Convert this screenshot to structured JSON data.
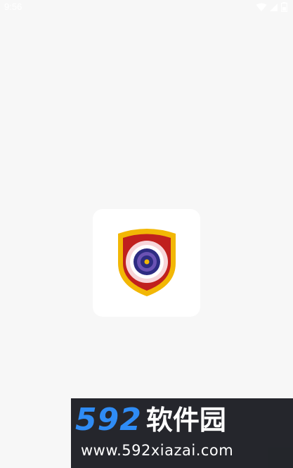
{
  "status_bar": {
    "time": "9:56",
    "icons": [
      "wifi-icon",
      "signal-icon",
      "battery-icon"
    ]
  },
  "splash": {
    "logo": "shield-target-logo",
    "colors": {
      "shield_outer": "#f2b705",
      "shield_inner": "#c0201e",
      "ring_light": "#f7d6da",
      "ring_dark": "#2d2c82",
      "center": "#f2b705"
    }
  },
  "watermark": {
    "brand_number": "592",
    "brand_text": "软件园",
    "url": "www.592xiazai.com",
    "colors": {
      "number": "#2f8cf5",
      "text": "#ffffff",
      "background": "#14161c"
    }
  }
}
